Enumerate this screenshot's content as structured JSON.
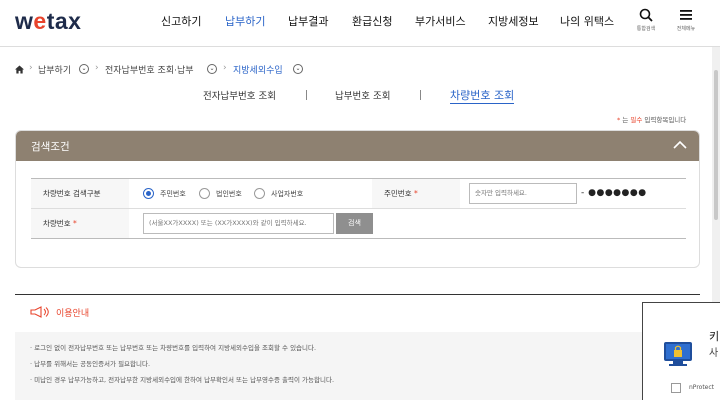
{
  "header": {
    "logo": {
      "pre": "w",
      "accent": "e",
      "post": "tax"
    },
    "menu": [
      "신고하기",
      "납부하기",
      "납부결과",
      "환급신청",
      "부가서비스",
      "지방세정보",
      "나의 위택스"
    ],
    "active_menu": "납부하기",
    "search_label": "통합검색",
    "allmenu_label": "전체메뉴"
  },
  "breadcrumb": {
    "home_icon": "home-icon",
    "items": [
      "납부하기",
      "전자납부번호 조회·납부",
      "지방세외수입"
    ]
  },
  "tabs": [
    "전자납부번호 조회",
    "납부번호 조회",
    "차량번호 조회"
  ],
  "active_tab": "차량번호 조회",
  "required_note": {
    "star": "*",
    "pre": " 는 ",
    "em": "필수",
    "post": " 입력항목입니다"
  },
  "search": {
    "title": "검색조건",
    "type_label": "차량번호 검색구분",
    "radio_options": [
      "주민번호",
      "법인번호",
      "사업자번호"
    ],
    "radio_selected": "주민번호",
    "id_label": "주민번호",
    "id_placeholder": "숫자만 입력하세요.",
    "id_masked": "- ●●●●●●●",
    "car_label": "차량번호",
    "car_placeholder": "(서울XX가XXXX) 또는 (XX가XXXX)와 같이 입력하세요.",
    "search_button": "검색"
  },
  "guide": {
    "title": "이용안내",
    "lines": [
      "· 로그인 없이 전자납부번호 또는 납부번호 또는 차량번호를 입력하여 지방세외수입을 조회할 수 있습니다.",
      "· 납부를 위해서는 공동인증서가 필요합니다.",
      "· 미납인 경우 납부가능하고, 전자납부한 지방세외수입에 한하여 납부확인서 또는 납부영수증 출력이 가능합니다."
    ]
  },
  "popup": {
    "title": "키",
    "subtitle": "사",
    "check_label": "nProtect"
  },
  "colors": {
    "accent_blue": "#2a64c8",
    "brand_red": "#e8442c",
    "panel_brown": "#8e8171",
    "logo_navy": "#1e2b4a"
  }
}
